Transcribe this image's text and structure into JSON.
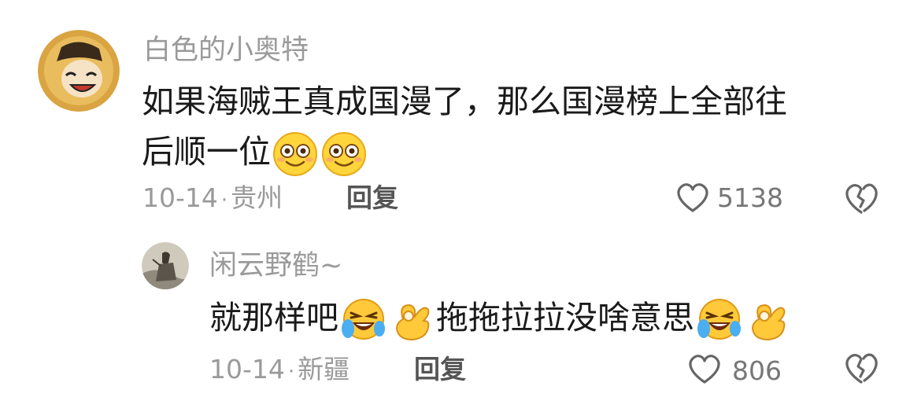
{
  "comment": {
    "username": "白色的小奥特",
    "text_line1": "如果海贼王真成国漫了，那么国漫榜上全部往",
    "text_line2": "后顺一位",
    "emojis": [
      "smile-face-emoji",
      "smile-face-emoji"
    ],
    "date": "10-14",
    "location": "贵州",
    "reply_label": "回复",
    "like_count": "5138"
  },
  "reply": {
    "username": "闲云野鹤~",
    "text_part1": "就那样吧",
    "text_part2": "拖拖拉拉没啥意思",
    "emojis": [
      "laughing-crying-emoji",
      "ok-hand-emoji",
      "laughing-crying-emoji",
      "ok-hand-emoji"
    ],
    "date": "10-14",
    "location": "新疆",
    "reply_label": "回复",
    "like_count": "806"
  },
  "watermark": "",
  "colors": {
    "text": "#1a1a1a",
    "secondary": "#9a9a9a",
    "icon": "#666666"
  }
}
